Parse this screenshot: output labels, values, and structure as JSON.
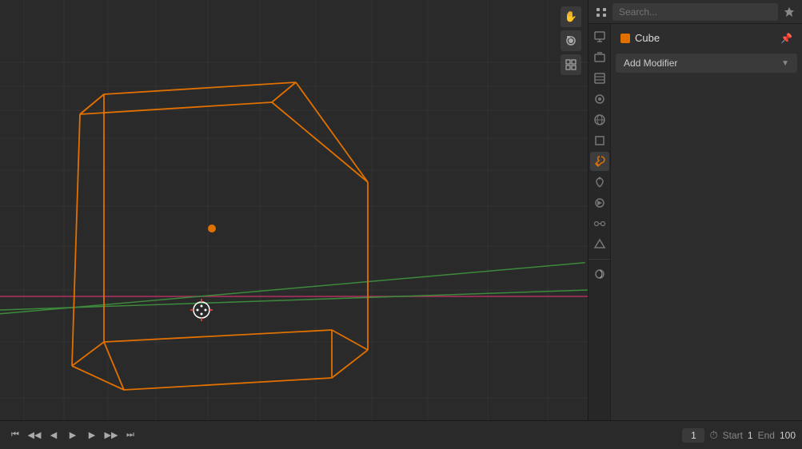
{
  "viewport": {
    "background_color": "#2a2a2a",
    "grid_color": "#3a3a3a",
    "axis_x_color": "#b03060",
    "axis_y_color": "#3d8a3d",
    "cube_color": "#e07000",
    "center_dot_color": "#e07000",
    "origin_color": "#ffffff"
  },
  "viewport_icons": [
    {
      "name": "hand-icon",
      "symbol": "✋",
      "tooltip": "Move"
    },
    {
      "name": "camera-movie-icon",
      "symbol": "🎥",
      "tooltip": "Camera"
    },
    {
      "name": "grid-icon",
      "symbol": "⊞",
      "tooltip": "Overlays"
    }
  ],
  "properties": {
    "search_placeholder": "Search...",
    "object_name": "Cube",
    "object_color": "#e07000",
    "add_modifier_label": "Add Modifier",
    "tabs": [
      {
        "id": "render",
        "symbol": "📷",
        "active": false
      },
      {
        "id": "output",
        "symbol": "🖨",
        "active": false
      },
      {
        "id": "view-layer",
        "symbol": "🗂",
        "active": false
      },
      {
        "id": "scene",
        "symbol": "🎬",
        "active": false
      },
      {
        "id": "world",
        "symbol": "🌐",
        "active": false
      },
      {
        "id": "object",
        "symbol": "▣",
        "active": false
      },
      {
        "id": "modifier",
        "symbol": "🔧",
        "active": true
      },
      {
        "id": "particles",
        "symbol": "✦",
        "active": false
      },
      {
        "id": "physics",
        "symbol": "⚡",
        "active": false
      },
      {
        "id": "constraints",
        "symbol": "🔗",
        "active": false
      },
      {
        "id": "data",
        "symbol": "△",
        "active": false
      }
    ]
  },
  "timeline": {
    "frame_current": "1",
    "frame_start_label": "Start",
    "frame_start_value": "1",
    "frame_end_label": "End",
    "frame_end_value": "100",
    "controls": [
      {
        "name": "jump-start-btn",
        "symbol": "⏮"
      },
      {
        "name": "prev-keyframe-btn",
        "symbol": "◀◀"
      },
      {
        "name": "step-back-btn",
        "symbol": "◀"
      },
      {
        "name": "play-btn",
        "symbol": "▶"
      },
      {
        "name": "step-fwd-btn",
        "symbol": "▶▶"
      },
      {
        "name": "next-keyframe-btn",
        "symbol": "▶▶"
      },
      {
        "name": "jump-end-btn",
        "symbol": "⏭"
      }
    ]
  }
}
